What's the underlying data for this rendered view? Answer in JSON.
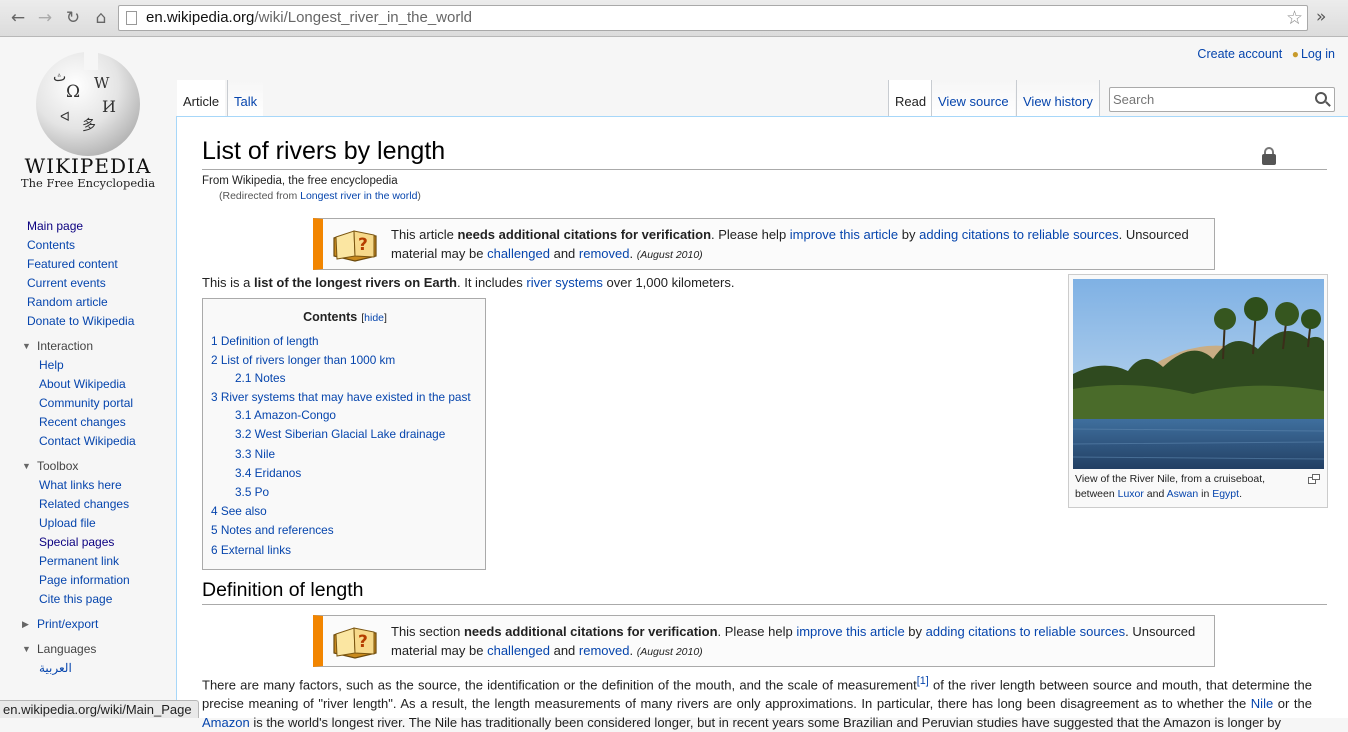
{
  "browser": {
    "url_host": "en.wikipedia.org",
    "url_path": "/wiki/Longest_river_in_the_world",
    "status_url": "en.wikipedia.org/wiki/Main_Page"
  },
  "logo": {
    "wordmark": "WIKIPEDIA",
    "tagline": "The Free Encyclopedia"
  },
  "sidebar": {
    "nav": [
      "Main page",
      "Contents",
      "Featured content",
      "Current events",
      "Random article",
      "Donate to Wikipedia"
    ],
    "interaction_heading": "Interaction",
    "interaction": [
      "Help",
      "About Wikipedia",
      "Community portal",
      "Recent changes",
      "Contact Wikipedia"
    ],
    "toolbox_heading": "Toolbox",
    "toolbox": [
      "What links here",
      "Related changes",
      "Upload file",
      "Special pages",
      "Permanent link",
      "Page information",
      "Cite this page"
    ],
    "print_heading": "Print/export",
    "languages_heading": "Languages",
    "languages": [
      "العربية"
    ]
  },
  "personal": {
    "create_account": "Create account",
    "login": "Log in"
  },
  "tabs": {
    "article": "Article",
    "talk": "Talk",
    "read": "Read",
    "view_source": "View source",
    "view_history": "View history"
  },
  "search": {
    "placeholder": "Search"
  },
  "article": {
    "title": "List of rivers by length",
    "from": "From Wikipedia, the free encyclopedia",
    "redirect_prefix": "(Redirected from ",
    "redirect_link": "Longest river in the world",
    "redirect_suffix": ")",
    "ambox1": {
      "t1": "This article ",
      "bold": "needs additional citations for verification",
      "t2": ". Please help ",
      "link1": "improve this article",
      "t3": " by ",
      "link2": "adding citations to reliable sources",
      "t4": ". Unsourced material may be ",
      "link3": "challenged",
      "t5": " and ",
      "link4": "removed",
      "t6": ". ",
      "date": "(August 2010)"
    },
    "intro": {
      "t1": "This is a ",
      "bold": "list of the longest rivers on Earth",
      "t2": ". It includes ",
      "link": "river systems",
      "t3": " over 1,000 kilometers."
    },
    "toc": {
      "title": "Contents",
      "hide": "hide",
      "entries": [
        "1 Definition of length",
        "2 List of rivers longer than 1000 km",
        "2.1 Notes",
        "3 River systems that may have existed in the past",
        "3.1 Amazon-Congo",
        "3.2 West Siberian Glacial Lake drainage",
        "3.3 Nile",
        "3.4 Eridanos",
        "3.5 Po",
        "4 See also",
        "5 Notes and references",
        "6 External links"
      ]
    },
    "thumb": {
      "caption1": "View of the River Nile, from a cruiseboat,",
      "caption2": "between ",
      "luxor": "Luxor",
      "and": " and ",
      "aswan": "Aswan",
      "in": " in ",
      "egypt": "Egypt",
      "dot": "."
    },
    "section_heading": "Definition of length",
    "ambox2": {
      "t1": "This section ",
      "bold": "needs additional citations for verification",
      "t2": ". Please help ",
      "link1": "improve this article",
      "t3": " by ",
      "link2": "adding citations to reliable sources",
      "t4": ". Unsourced material may be ",
      "link3": "challenged",
      "t5": " and ",
      "link4": "removed",
      "t6": ". ",
      "date": "(August 2010)"
    },
    "para": {
      "t1": "There are many factors, such as the source, the identification or the definition of the mouth, and the scale of measurement",
      "ref": "[1]",
      "t2": " of the river length between source and mouth, that determine the precise meaning of \"river length\". As a result, the length measurements of many rivers are only approximations. In particular, there has long been disagreement as to whether the ",
      "nile": "Nile",
      "t3": " or the ",
      "amazon": "Amazon",
      "t4": " is the world's longest river. The Nile has traditionally been considered longer, but in recent years some Brazilian and Peruvian studies have suggested that the Amazon is longer by"
    }
  },
  "colors": {
    "link": "#0645ad",
    "ambox_accent": "#f28500",
    "border_blue": "#a7d7f9"
  }
}
